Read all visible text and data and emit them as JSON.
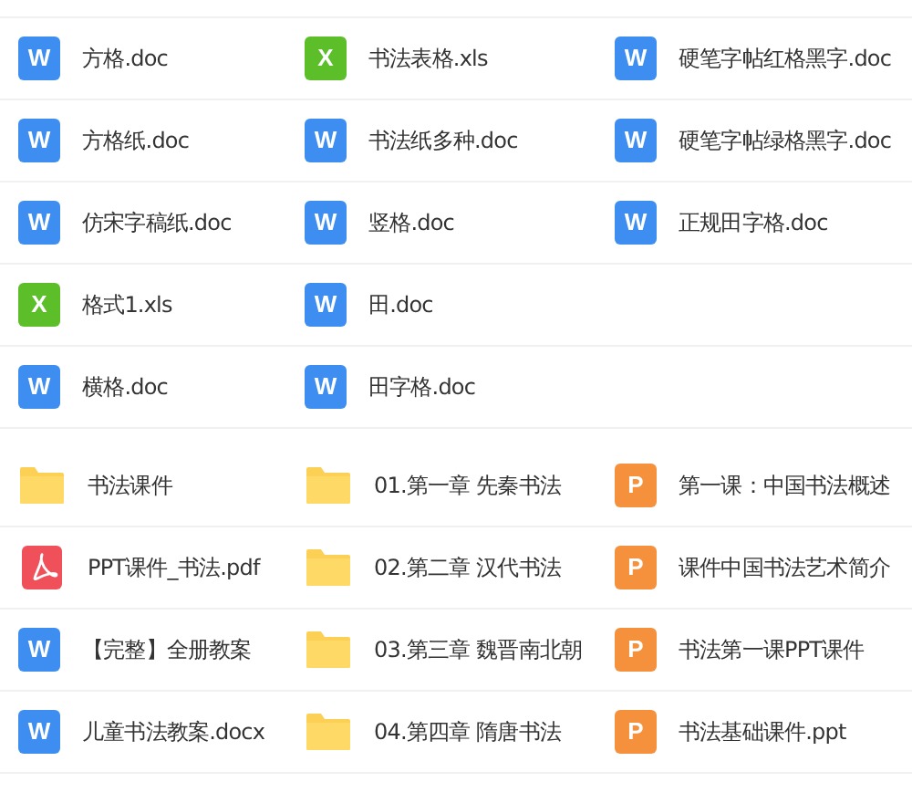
{
  "sections": [
    {
      "rows": [
        {
          "cells": [
            {
              "kind": "word",
              "badge": "W",
              "name": "方格.doc"
            },
            {
              "kind": "excel",
              "badge": "X",
              "name": "书法表格.xls"
            },
            {
              "kind": "word",
              "badge": "W",
              "name": "硬笔字帖红格黑字.doc"
            }
          ]
        },
        {
          "cells": [
            {
              "kind": "word",
              "badge": "W",
              "name": "方格纸.doc"
            },
            {
              "kind": "word",
              "badge": "W",
              "name": "书法纸多种.doc"
            },
            {
              "kind": "word",
              "badge": "W",
              "name": "硬笔字帖绿格黑字.doc"
            }
          ]
        },
        {
          "cells": [
            {
              "kind": "word",
              "badge": "W",
              "name": "仿宋字稿纸.doc"
            },
            {
              "kind": "word",
              "badge": "W",
              "name": "竖格.doc"
            },
            {
              "kind": "word",
              "badge": "W",
              "name": "正规田字格.doc"
            }
          ]
        },
        {
          "cells": [
            {
              "kind": "excel",
              "badge": "X",
              "name": "格式1.xls"
            },
            {
              "kind": "word",
              "badge": "W",
              "name": "田.doc"
            }
          ]
        },
        {
          "cells": [
            {
              "kind": "word",
              "badge": "W",
              "name": "横格.doc"
            },
            {
              "kind": "word",
              "badge": "W",
              "name": "田字格.doc"
            }
          ]
        }
      ]
    },
    {
      "rows": [
        {
          "cells": [
            {
              "kind": "folder",
              "name": "书法课件"
            },
            {
              "kind": "folder",
              "name": "01.第一章 先秦书法"
            },
            {
              "kind": "ppt",
              "badge": "P",
              "name": "第一课：中国书法概述"
            }
          ]
        },
        {
          "cells": [
            {
              "kind": "pdf",
              "name": "PPT课件_书法.pdf"
            },
            {
              "kind": "folder",
              "name": "02.第二章 汉代书法"
            },
            {
              "kind": "ppt",
              "badge": "P",
              "name": "课件中国书法艺术简介"
            }
          ]
        },
        {
          "cells": [
            {
              "kind": "word",
              "badge": "W",
              "name": "【完整】全册教案"
            },
            {
              "kind": "folder",
              "name": "03.第三章 魏晋南北朝"
            },
            {
              "kind": "ppt",
              "badge": "P",
              "name": "书法第一课PPT课件"
            }
          ]
        },
        {
          "cells": [
            {
              "kind": "word",
              "badge": "W",
              "name": "儿童书法教案.docx"
            },
            {
              "kind": "folder",
              "name": "04.第四章 隋唐书法"
            },
            {
              "kind": "ppt",
              "badge": "P",
              "name": "书法基础课件.ppt"
            }
          ]
        }
      ]
    }
  ]
}
